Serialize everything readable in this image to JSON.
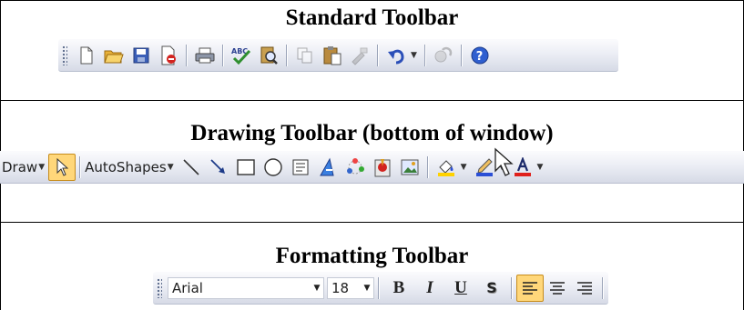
{
  "standard": {
    "title": "Standard Toolbar",
    "buttons": [
      "new-icon",
      "open-icon",
      "save-icon",
      "permission-icon",
      "print-icon",
      "spelling-icon",
      "research-icon",
      "copy-icon",
      "paste-icon",
      "format-painter-icon",
      "undo-icon",
      "hyperlink-icon",
      "help-icon"
    ]
  },
  "drawing": {
    "title": "Drawing Toolbar (bottom of window)",
    "draw_label": "Draw",
    "autoshapes_label": "AutoShapes",
    "buttons": [
      "select-objects-icon",
      "line-icon",
      "arrow-icon",
      "rectangle-icon",
      "oval-icon",
      "textbox-icon",
      "wordart-icon",
      "diagram-icon",
      "clipart-icon",
      "picture-icon",
      "fill-color-icon",
      "line-color-icon",
      "font-color-icon"
    ]
  },
  "formatting": {
    "title": "Formatting Toolbar",
    "font": "Arial",
    "size": "18",
    "bold": "B",
    "italic": "I",
    "underline": "U",
    "shadow": "S",
    "align_buttons": [
      "align-left-icon",
      "center-icon",
      "align-right-icon"
    ]
  },
  "colors": {
    "accent": "#ffd77a",
    "fill": "#ffd200",
    "line": "#2b4fd6",
    "font": "#e0201b"
  }
}
